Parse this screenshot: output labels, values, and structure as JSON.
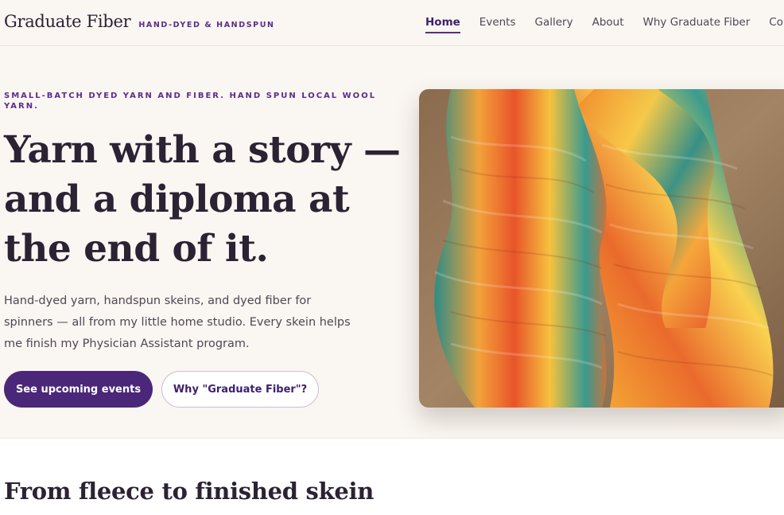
{
  "header": {
    "brand_name": "Graduate Fiber",
    "brand_tagline": "HAND-DYED & HANDSPUN",
    "nav": [
      {
        "label": "Home",
        "active": true
      },
      {
        "label": "Events",
        "active": false
      },
      {
        "label": "Gallery",
        "active": false
      },
      {
        "label": "About",
        "active": false
      },
      {
        "label": "Why Graduate Fiber",
        "active": false
      },
      {
        "label": "Contact",
        "active": false
      }
    ]
  },
  "hero": {
    "eyebrow": "Small-batch dyed yarn and fiber. Hand spun local wool yarn.",
    "title": "Yarn with a story — and a diploma at the end of it.",
    "text": "Hand-dyed yarn, handspun skeins, and dyed fiber for spinners — all from my little home studio. Every skein helps me finish my Physician Assistant program.",
    "primary_button": "See upcoming events",
    "secondary_button": "Why \"Graduate Fiber\"?",
    "image_icon": "yarn-skeins-photo"
  },
  "section": {
    "title": "From fleece to finished skein"
  },
  "colors": {
    "accent": "#5b2d8c",
    "primary_button": "#4a2778",
    "background": "#faf6f1",
    "text": "#2b2234"
  }
}
